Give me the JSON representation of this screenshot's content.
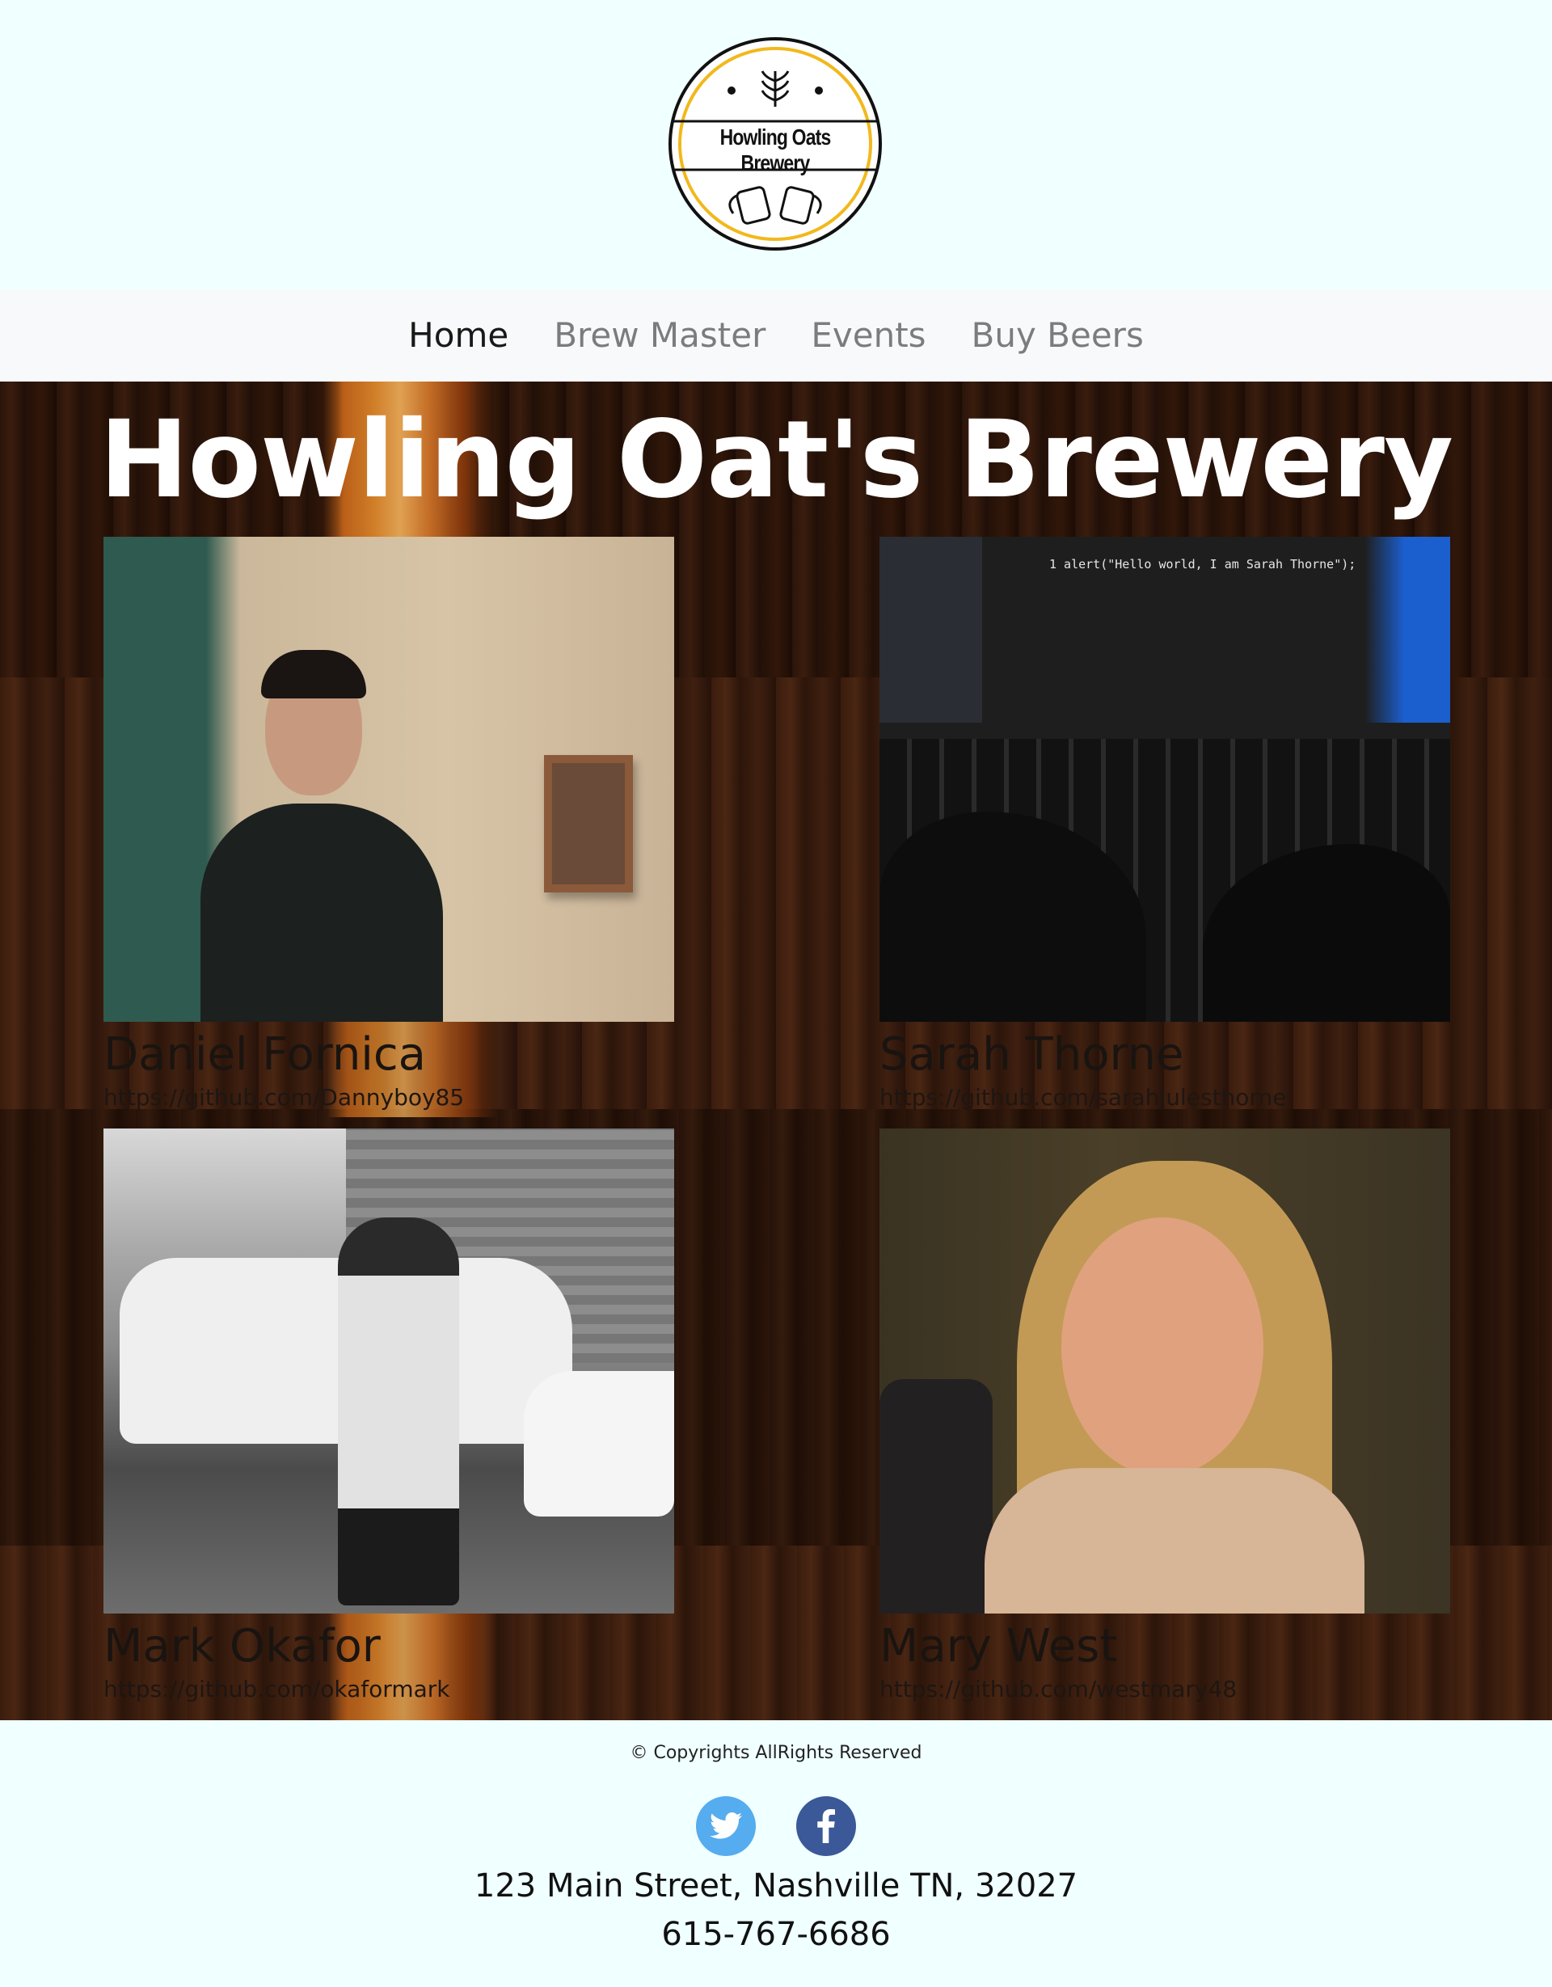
{
  "logo": {
    "text": "Howling Oats Brewery",
    "ring_color": "#f2b81c"
  },
  "nav": {
    "items": [
      {
        "label": "Home",
        "active": true
      },
      {
        "label": "Brew Master",
        "active": false
      },
      {
        "label": "Events",
        "active": false
      },
      {
        "label": "Buy Beers",
        "active": false
      }
    ]
  },
  "hero": {
    "title": "Howling Oat's Brewery"
  },
  "team": [
    {
      "name": "Daniel Fornica",
      "link": "https://github.com/Dannyboy85"
    },
    {
      "name": "Sarah Thorne",
      "link": "https://github.com/sarahjulesthorne"
    },
    {
      "name": "Mark Okafor",
      "link": "https://github.com/okaformark"
    },
    {
      "name": "Mary West",
      "link": "https://github.com/westmary48"
    }
  ],
  "photo2": {
    "code_line": "1 alert(\"Hello world, I am Sarah Thorne\");"
  },
  "footer": {
    "copyright": "© Copyrights AllRights Reserved",
    "social": [
      {
        "icon": "twitter-icon",
        "color": "#55acee"
      },
      {
        "icon": "facebook-icon",
        "color": "#3b5998"
      }
    ],
    "address": "123 Main Street, Nashville TN, 32027",
    "phone": "615-767-6686"
  }
}
